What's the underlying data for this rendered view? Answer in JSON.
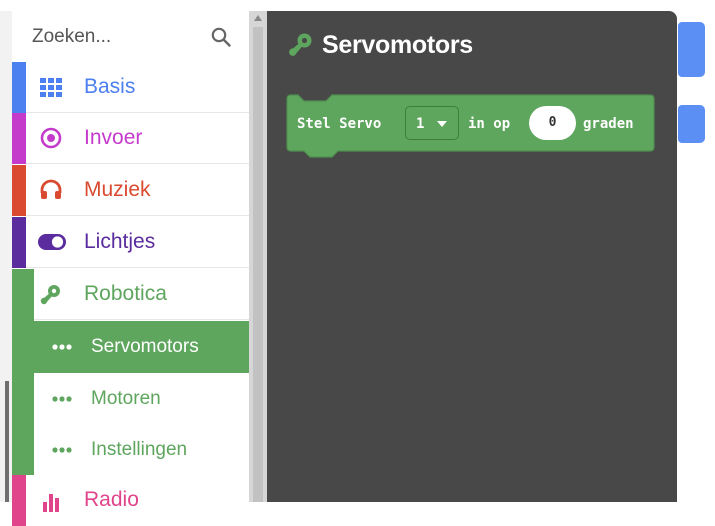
{
  "search": {
    "placeholder": "Zoeken..."
  },
  "categories": [
    {
      "label": "Basis",
      "color": "#4c7ff0",
      "icon": "grid-icon"
    },
    {
      "label": "Invoer",
      "color": "#c43bcc",
      "icon": "target-icon"
    },
    {
      "label": "Muziek",
      "color": "#d94a30",
      "icon": "headphones-icon"
    },
    {
      "label": "Lichtjes",
      "color": "#5b2c9e",
      "icon": "toggle-icon"
    },
    {
      "label": "Robotica",
      "color": "#5ea55e",
      "icon": "robot-arm-icon"
    },
    {
      "label": "Radio",
      "color": "#e0458b",
      "icon": "bar-chart-icon"
    }
  ],
  "subcategories": [
    {
      "label": "Servomotors",
      "selected": true
    },
    {
      "label": "Motoren",
      "selected": false
    },
    {
      "label": "Instellingen",
      "selected": false
    }
  ],
  "flyout": {
    "title": "Servomotors",
    "block": {
      "prefix": "Stel Servo",
      "servo_value": "1",
      "middle": "in op",
      "angle_value": "0",
      "suffix": "graden",
      "color": "#5ea55e"
    }
  }
}
